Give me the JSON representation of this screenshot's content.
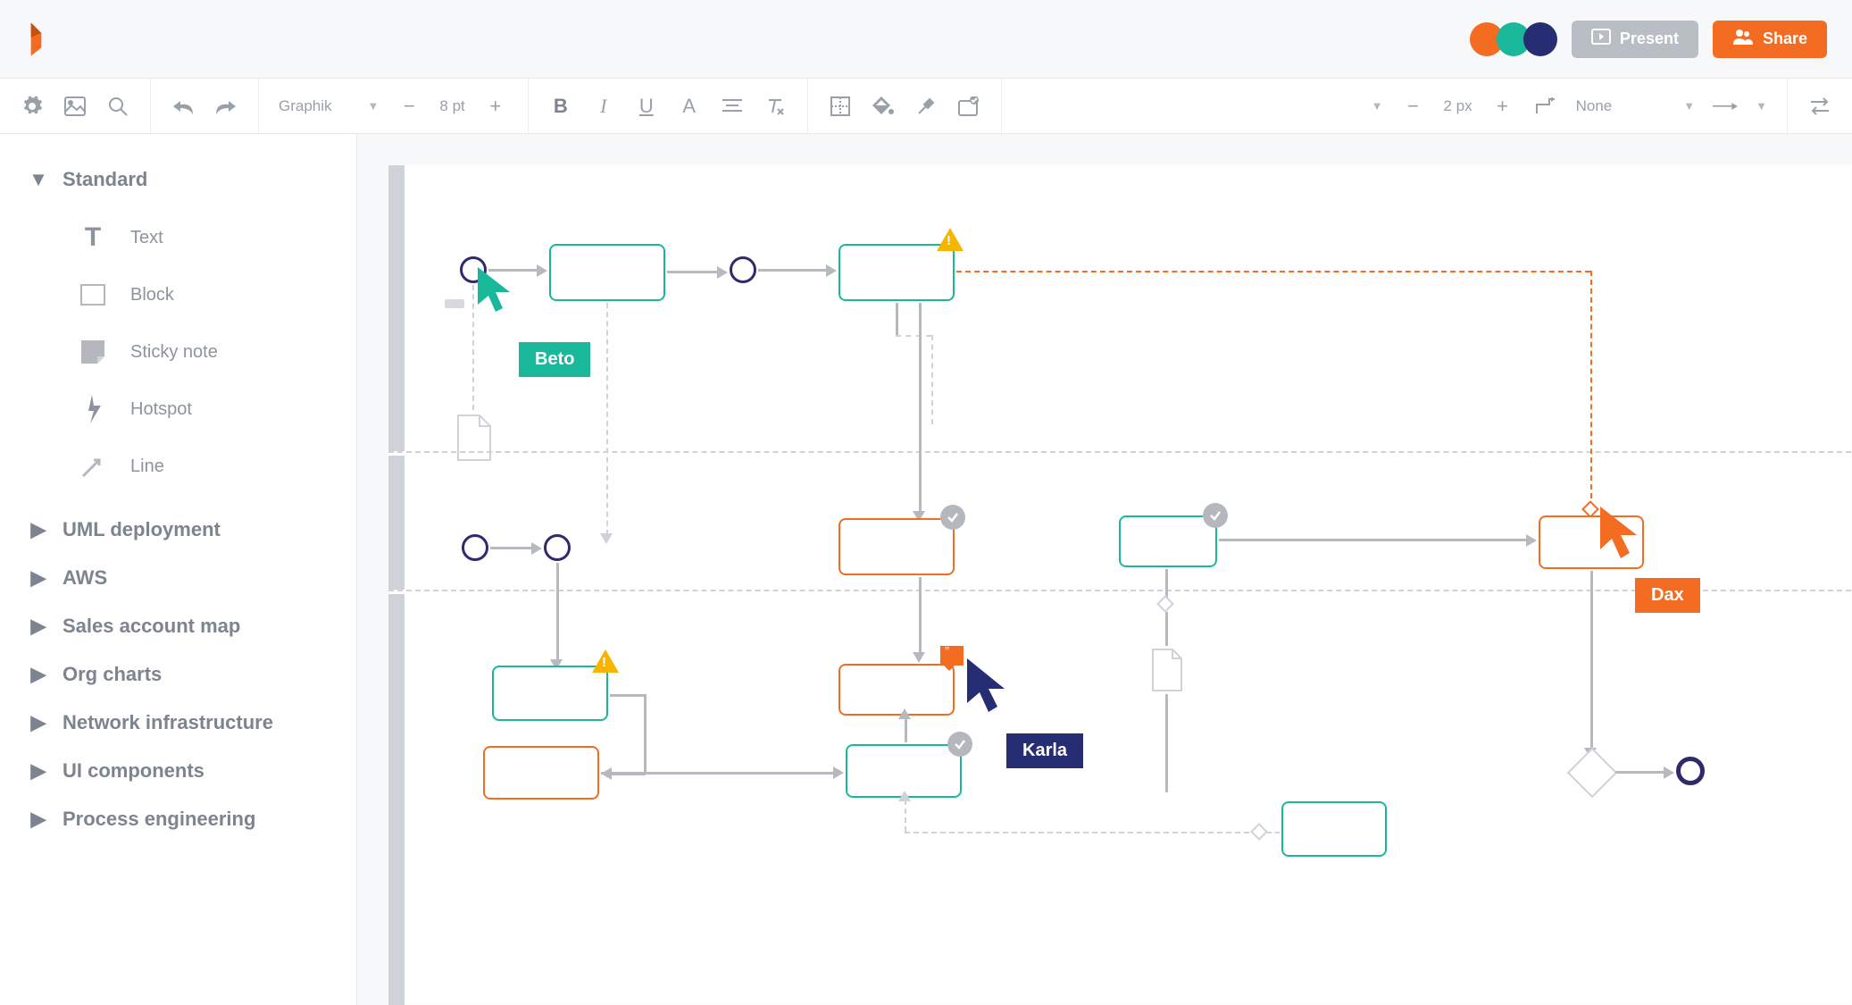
{
  "header": {
    "present_label": "Present",
    "share_label": "Share",
    "presence_colors": [
      "#f36c21",
      "#19b89a",
      "#272d73"
    ]
  },
  "toolbar": {
    "font_family": "Graphik",
    "font_size": "8 pt",
    "stroke_width": "2 px",
    "line_end_style": "None"
  },
  "sidebar": {
    "sections": [
      {
        "label": "Standard",
        "expanded": true,
        "items": [
          {
            "label": "Text"
          },
          {
            "label": "Block"
          },
          {
            "label": "Sticky note"
          },
          {
            "label": "Hotspot"
          },
          {
            "label": "Line"
          }
        ]
      },
      {
        "label": "UML deployment",
        "expanded": false
      },
      {
        "label": "AWS",
        "expanded": false
      },
      {
        "label": "Sales account map",
        "expanded": false
      },
      {
        "label": "Org charts",
        "expanded": false
      },
      {
        "label": "Network infrastructure",
        "expanded": false
      },
      {
        "label": "UI components",
        "expanded": false
      },
      {
        "label": "Process engineering",
        "expanded": false
      }
    ]
  },
  "canvas": {
    "collaborators": [
      {
        "name": "Beto",
        "color": "teal"
      },
      {
        "name": "Karla",
        "color": "navy"
      },
      {
        "name": "Dax",
        "color": "orange"
      }
    ]
  }
}
